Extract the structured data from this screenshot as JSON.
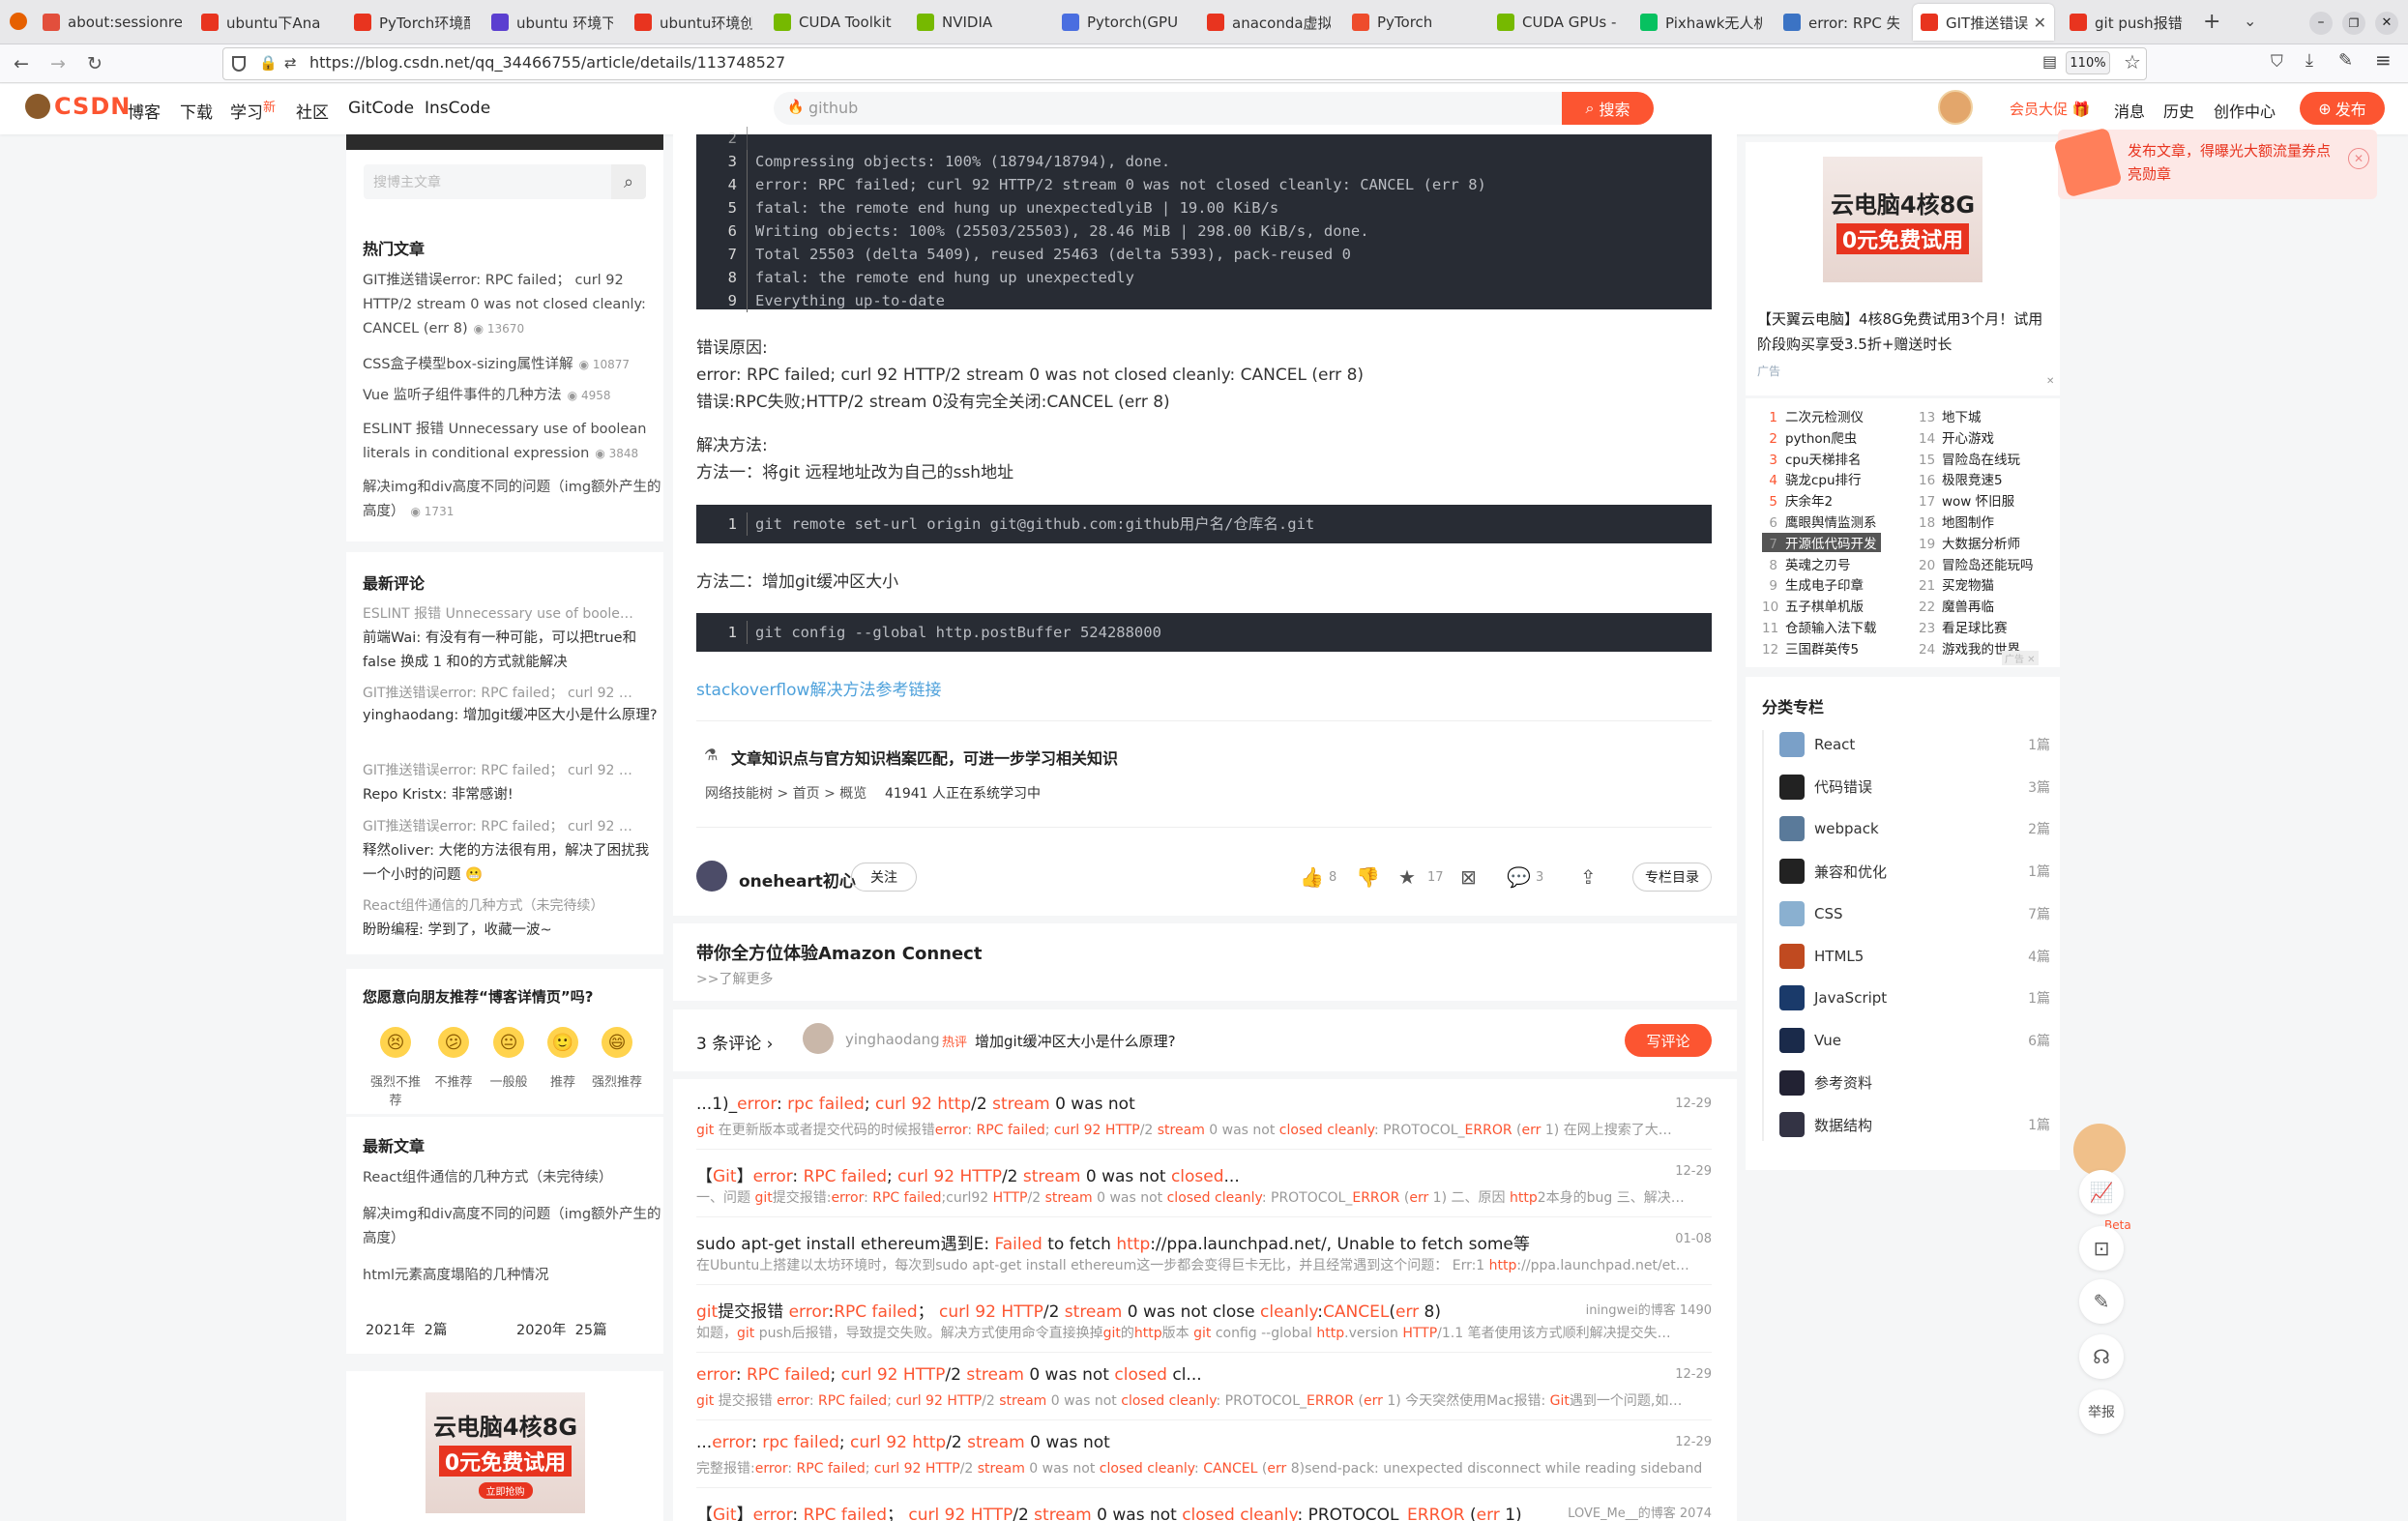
{
  "browser": {
    "tabs": [
      {
        "title": "about:sessionrestore",
        "color": "#e24f3c"
      },
      {
        "title": "ubuntu下Ana",
        "color": "#e8341f"
      },
      {
        "title": "PyTorch环境配",
        "color": "#e8341f"
      },
      {
        "title": "ubuntu 环境下",
        "color": "#5b3fd0"
      },
      {
        "title": "ubuntu环境创",
        "color": "#e8341f"
      },
      {
        "title": "CUDA Toolkit",
        "color": "#76b900"
      },
      {
        "title": "NVIDIA",
        "color": "#76b900"
      },
      {
        "title": "Pytorch(GPU",
        "color": "#4a6ee0"
      },
      {
        "title": "anaconda虚拟",
        "color": "#e8341f"
      },
      {
        "title": "PyTorch",
        "color": "#ee4c2c"
      },
      {
        "title": "CUDA GPUs -",
        "color": "#76b900"
      },
      {
        "title": "Pixhawk无人机",
        "color": "#07c160"
      },
      {
        "title": "error: RPC 失",
        "color": "#3b73c4"
      },
      {
        "title": "GIT推送错误e",
        "color": "#e8341f"
      },
      {
        "title": "git push报错",
        "color": "#e8341f"
      }
    ],
    "url": "https://blog.csdn.net/qq_34466755/article/details/113748527",
    "zoom": "110%"
  },
  "header": {
    "logo": "CSDN",
    "nav": [
      "博客",
      "下载",
      "学习",
      "社区",
      "GitCode",
      "InsCode"
    ],
    "nav_badge": "新",
    "search_placeholder": "github",
    "search_button": "搜索",
    "vip": "会员大促",
    "links": [
      "消息",
      "历史",
      "创作中心"
    ],
    "publish": "发布"
  },
  "left": {
    "search_placeholder": "搜博主文章",
    "hot_title": "热门文章",
    "hot": [
      {
        "title": "GIT推送错误error: RPC failed； curl 92 HTTP/2 stream 0 was not closed cleanly: CANCEL (err 8)",
        "views": "13670"
      },
      {
        "title": "CSS盒子模型box-sizing属性详解",
        "views": "10877"
      },
      {
        "title": "Vue 监听子组件事件的几种方法",
        "views": "4958"
      },
      {
        "title": "ESLINT 报错 Unnecessary use of boolean literals in conditional expression",
        "views": "3848"
      },
      {
        "title": "解决img和div高度不同的问题（img额外产生的高度）",
        "views": "1731"
      }
    ],
    "comments_title": "最新评论",
    "comments": [
      {
        "article": "ESLINT 报错 Unnecessary use of boole…",
        "body": "前端Wai: 有没有有一种可能，可以把true和false 换成 1 和0的方式就能解决"
      },
      {
        "article": "GIT推送错误error: RPC failed；  curl 92 …",
        "body": "yinghaodang: 增加git缓冲区大小是什么原理?"
      },
      {
        "article": "GIT推送错误error: RPC failed；  curl 92 …",
        "body": "Repo Kristx: 非常感谢!"
      },
      {
        "article": "GIT推送错误error: RPC failed；  curl 92 …",
        "body": "释然oliver: 大佬的方法很有用，解决了困扰我一个小时的问题 😬"
      },
      {
        "article": "React组件通信的几种方式（未完待续）",
        "body": "盼盼编程: 学到了，收藏一波~"
      }
    ],
    "recommend_title": "您愿意向朋友推荐“博客详情页”吗?",
    "recommend_options": [
      "强烈不推荐",
      "不推荐",
      "一般般",
      "推荐",
      "强烈推荐"
    ],
    "recommend_faces": [
      "😣",
      "😕",
      "😐",
      "🙂",
      "😄"
    ],
    "latest_title": "最新文章",
    "latest": [
      "React组件通信的几种方式（未完待续）",
      "解决img和div高度不同的问题（img额外产生的高度）",
      "html元素高度塌陷的几种情况"
    ],
    "archive": [
      "2021年  2篇",
      "2020年  25篇"
    ],
    "ad": {
      "line1": "云电脑4核8G",
      "line2": "0元免费试用",
      "button": "立即抢购"
    }
  },
  "article": {
    "code1": [
      {
        "n": "3",
        "t": "Compressing objects: 100% (18794/18794), done."
      },
      {
        "n": "4",
        "t": "error: RPC failed; curl 92 HTTP/2 stream 0 was not closed cleanly: CANCEL (err 8)"
      },
      {
        "n": "5",
        "t": "fatal: the remote end hung up unexpectedlyiB | 19.00 KiB/s"
      },
      {
        "n": "6",
        "t": "Writing objects: 100% (25503/25503), 28.46 MiB | 298.00 KiB/s, done."
      },
      {
        "n": "7",
        "t": "Total 25503 (delta 5409), reused 25463 (delta 5393), pack-reused 0"
      },
      {
        "n": "8",
        "t": "fatal: the remote end hung up unexpectedly"
      },
      {
        "n": "9",
        "t": "Everything up-to-date"
      }
    ],
    "reason_title": "错误原因:",
    "reason_1": "error: RPC failed; curl 92 HTTP/2 stream 0 was not closed cleanly: CANCEL (err 8)",
    "reason_2": "错误:RPC失败;HTTP/2 stream 0没有完全关闭:CANCEL (err 8)",
    "solution_title": "解决方法:",
    "solution_1": "方法一：将git 远程地址改为自己的ssh地址",
    "code2": {
      "n": "1",
      "t": "git remote set-url origin git@github.com:github用户名/仓库名.git"
    },
    "solution_2": "方法二：增加git缓冲区大小",
    "code3": {
      "n": "1",
      "t": "git config --global http.postBuffer 524288000"
    },
    "link": "stackoverflow解决方法参考链接",
    "knowledge_title": "文章知识点与官方知识档案匹配，可进一步学习相关知识",
    "knowledge_path": "网络技能树 > 首页 > 概览",
    "knowledge_count": "41941 人正在系统学习中",
    "author": "oneheart初心",
    "follow": "关注",
    "likes": "8",
    "stars": "17",
    "comments_count": "3",
    "column_btn": "专栏目录"
  },
  "promo": {
    "title": "带你全方位体验Amazon Connect",
    "sub": ">>了解更多"
  },
  "comment_bar": {
    "count": "3 条评论",
    "user": "yinghaodang",
    "hot": "热评",
    "text": "增加git缓冲区大小是什么原理?",
    "button": "写评论"
  },
  "related": [
    {
      "title": "...1)_error: rpc failed; curl 92 http/2 stream 0 was not",
      "desc": "git 在更新版本或者提交代码的时候报错error: RPC failed; curl 92 HTTP/2 stream 0 was not closed cleanly: PROTOCOL_ERROR (err 1) 在网上搜索了大…",
      "date": "12-29"
    },
    {
      "title": "【Git】error: RPC failed; curl 92 HTTP/2 stream 0 was not closed...",
      "desc": "一、问题 git提交报错:error: RPC failed;curl92 HTTP/2 stream 0 was not closed cleanly: PROTOCOL_ERROR (err 1) 二、原因 http2本身的bug 三、解决…",
      "date": "12-29"
    },
    {
      "title": "sudo apt-get install ethereum遇到E: Failed to fetch http://ppa.launchpad.net/, Unable to fetch some等",
      "desc": "在Ubuntu上搭建以太坊环境时，每次到sudo apt-get install ethereum这一步都会变得巨卡无比，并且经常遇到这个问题：  Err:1 http://ppa.launchpad.net/et…",
      "date": "01-08"
    },
    {
      "title": "git提交报错 error:RPC failed；  curl 92 HTTP/2 stream 0 was not close cleanly:CANCEL(err 8)",
      "desc": "如题，git push后报错，导致提交失败。解决方式使用命令直接换掉git的http版本 git config --global http.version HTTP/1.1 笔者使用该方式顺利解决提交失…",
      "date": "iningwei的博客  1490"
    },
    {
      "title": "error: RPC failed; curl 92 HTTP/2 stream 0 was not closed cl...",
      "desc": "git 提交报错 error: RPC failed; curl 92 HTTP/2 stream 0 was not closed cleanly: PROTOCOL_ERROR (err 1) 今天突然使用Mac报错: Git遇到一个问题,如…",
      "date": "12-29"
    },
    {
      "title": "...error: rpc failed; curl 92 http/2 stream 0 was not",
      "desc": "完整报错:error: RPC failed; curl 92 HTTP/2 stream 0 was not closed cleanly: CANCEL (err 8)send-pack: unexpected disconnect while reading sideband …",
      "date": "12-29"
    },
    {
      "title": "【Git】error: RPC failed；  curl 92 HTTP/2 stream 0 was not closed cleanly: PROTOCOL_ERROR (err 1)",
      "desc": "",
      "date": "LOVE_Me__的博客  2074"
    }
  ],
  "right": {
    "ad_title": "【天翼云电脑】4核8G免费试用3个月！试用阶段购买享受3.5折+赠送时长",
    "ad_flag": "广告",
    "ad_line1": "云电脑4核8G",
    "ad_line2": "0元免费试用",
    "popup": "发布文章，得曝光大额流量券点亮勋章",
    "trends_left": [
      "二次元检测仪",
      "python爬虫",
      "cpu天梯排名",
      "骁龙cpu排行",
      "庆余年2",
      "鹰眼舆情监测系",
      "开源低代码开发",
      "英魂之刃号",
      "生成电子印章",
      "五子棋单机版",
      "仓颉输入法下载",
      "三国群英传5"
    ],
    "trends_right": [
      "地下城",
      "开心游戏",
      "冒险岛在线玩",
      "极限竞速5",
      "wow 怀旧服",
      "地图制作",
      "大数据分析师",
      "冒险岛还能玩吗",
      "买宠物猫",
      "魔兽再临",
      "看足球比赛",
      "游戏我的世界"
    ],
    "columns_title": "分类专栏",
    "columns": [
      {
        "name": "React",
        "count": "1篇"
      },
      {
        "name": "代码错误",
        "count": "3篇"
      },
      {
        "name": "webpack",
        "count": "2篇"
      },
      {
        "name": "兼容和优化",
        "count": "1篇"
      },
      {
        "name": "CSS",
        "count": "7篇"
      },
      {
        "name": "HTML5",
        "count": "4篇"
      },
      {
        "name": "JavaScript",
        "count": "1篇"
      },
      {
        "name": "Vue",
        "count": "6篇"
      },
      {
        "name": "参考资料",
        "count": ""
      },
      {
        "name": "数据结构",
        "count": "1篇"
      }
    ],
    "beta": "Beta",
    "report": "举报"
  }
}
